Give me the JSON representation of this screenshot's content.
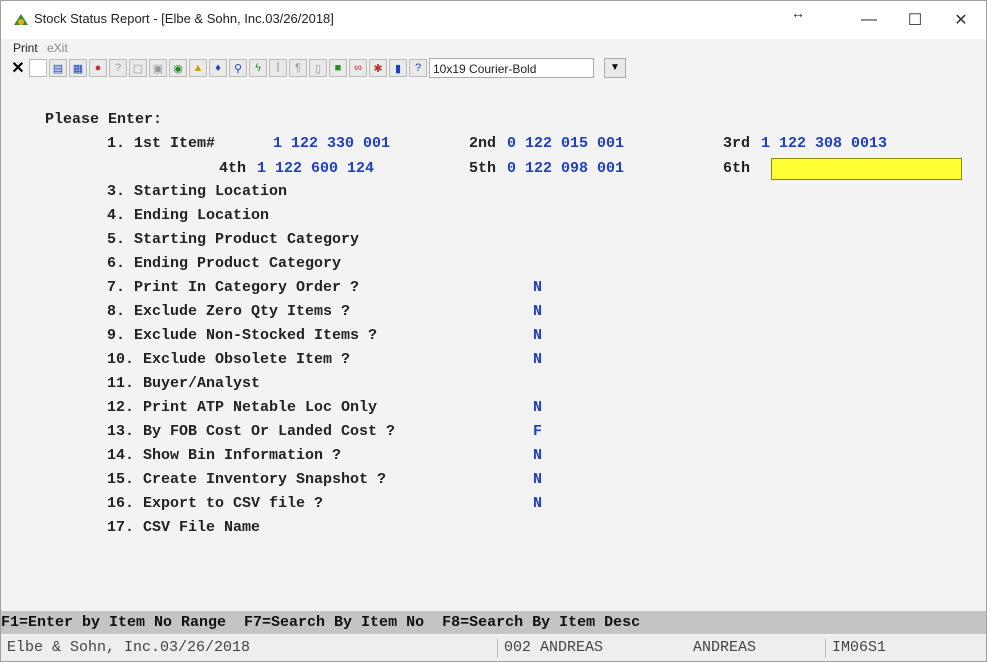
{
  "window": {
    "title": "Stock Status Report - [Elbe & Sohn, Inc.03/26/2018]",
    "controls": {
      "minimize": "—",
      "maximize": "☐",
      "close": "✕",
      "resize": "↔"
    }
  },
  "menu": {
    "print": "Print",
    "exit": "eXit"
  },
  "toolbar": {
    "icons": [
      "close-x-icon",
      "new-icon",
      "copy-icon",
      "paste-icon",
      "record-icon",
      "help-icon",
      "calc-icon",
      "globe-icon",
      "warning-icon",
      "find-icon",
      "search-icon",
      "lightning-icon",
      "edit-icon",
      "page-icon",
      "text-icon",
      "camera-icon",
      "link-icon",
      "run-icon",
      "db-icon",
      "help-pointer-icon"
    ],
    "font_value": "10x19 Courier-Bold",
    "dropdown_glyph": "▼"
  },
  "form": {
    "heading": "Please Enter:",
    "item_row1": {
      "label1": "1. 1st Item#",
      "value1": "1 122 330 001",
      "label2": "2nd",
      "value2": "0 122 015 001",
      "label3": "3rd",
      "value3": "1 122 308 0013"
    },
    "item_row2": {
      "label4": "4th",
      "value4": "1 122 600 124",
      "label5": "5th",
      "value5": "0 122 098 001",
      "label6": "6th",
      "value6": ""
    },
    "fields": [
      {
        "label": "3. Starting Location",
        "value": ""
      },
      {
        "label": "4. Ending Location",
        "value": ""
      },
      {
        "label": "5. Starting Product Category",
        "value": ""
      },
      {
        "label": "6. Ending Product Category",
        "value": ""
      },
      {
        "label": "7. Print In Category Order ?",
        "value": "N"
      },
      {
        "label": "8. Exclude Zero Qty Items ?",
        "value": "N"
      },
      {
        "label": "9. Exclude Non-Stocked Items ?",
        "value": "N"
      },
      {
        "label": "10. Exclude Obsolete Item ?",
        "value": "N"
      },
      {
        "label": "11. Buyer/Analyst",
        "value": ""
      },
      {
        "label": "12. Print ATP Netable Loc Only",
        "value": "N"
      },
      {
        "label": "13. By FOB Cost Or Landed Cost ?",
        "value": "F"
      },
      {
        "label": "14. Show Bin Information ?",
        "value": "N"
      },
      {
        "label": "15. Create Inventory Snapshot ?",
        "value": "N"
      },
      {
        "label": "16. Export to CSV file ?",
        "value": "N"
      },
      {
        "label": "17. CSV File Name",
        "value": ""
      }
    ]
  },
  "fkeys": {
    "text": "F1=Enter by Item No Range  F7=Search By Item No  F8=Search By Item Desc"
  },
  "statusbar": {
    "company": "Elbe & Sohn, Inc.03/26/2018",
    "user_code": "002 ANDREAS",
    "user_name": "ANDREAS",
    "screen_id": "IM06S1"
  },
  "colors": {
    "value_blue": "#1f3fbf",
    "input_yellow": "#ffff33"
  }
}
